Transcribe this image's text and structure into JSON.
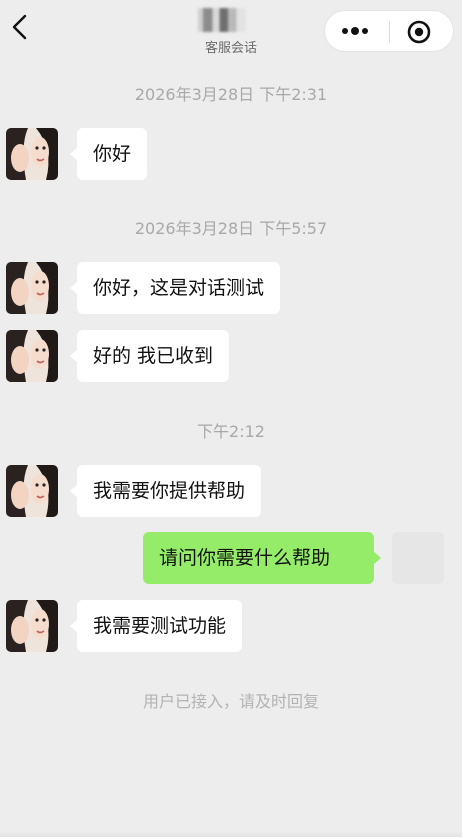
{
  "header": {
    "subtitle": "客服会话",
    "icons": {
      "back": "chevron-left-icon",
      "more": "more-dots-icon",
      "close": "miniprogram-close-icon"
    }
  },
  "messages": {
    "ts1": "2026年3月28日 下午2:31",
    "m1": "你好",
    "ts2": "2026年3月28日 下午5:57",
    "m2": "你好，这是对话测试",
    "m3": "好的 我已收到",
    "ts3": "下午2:12",
    "m4": "我需要你提供帮助",
    "m5": "请问你需要什么帮助",
    "m6": "我需要测试功能",
    "system": "用户已接入，请及时回复"
  },
  "colors": {
    "background": "#ededed",
    "incoming_bubble": "#ffffff",
    "outgoing_bubble": "#95ec69",
    "timestamp_text": "#a8a8a8"
  }
}
